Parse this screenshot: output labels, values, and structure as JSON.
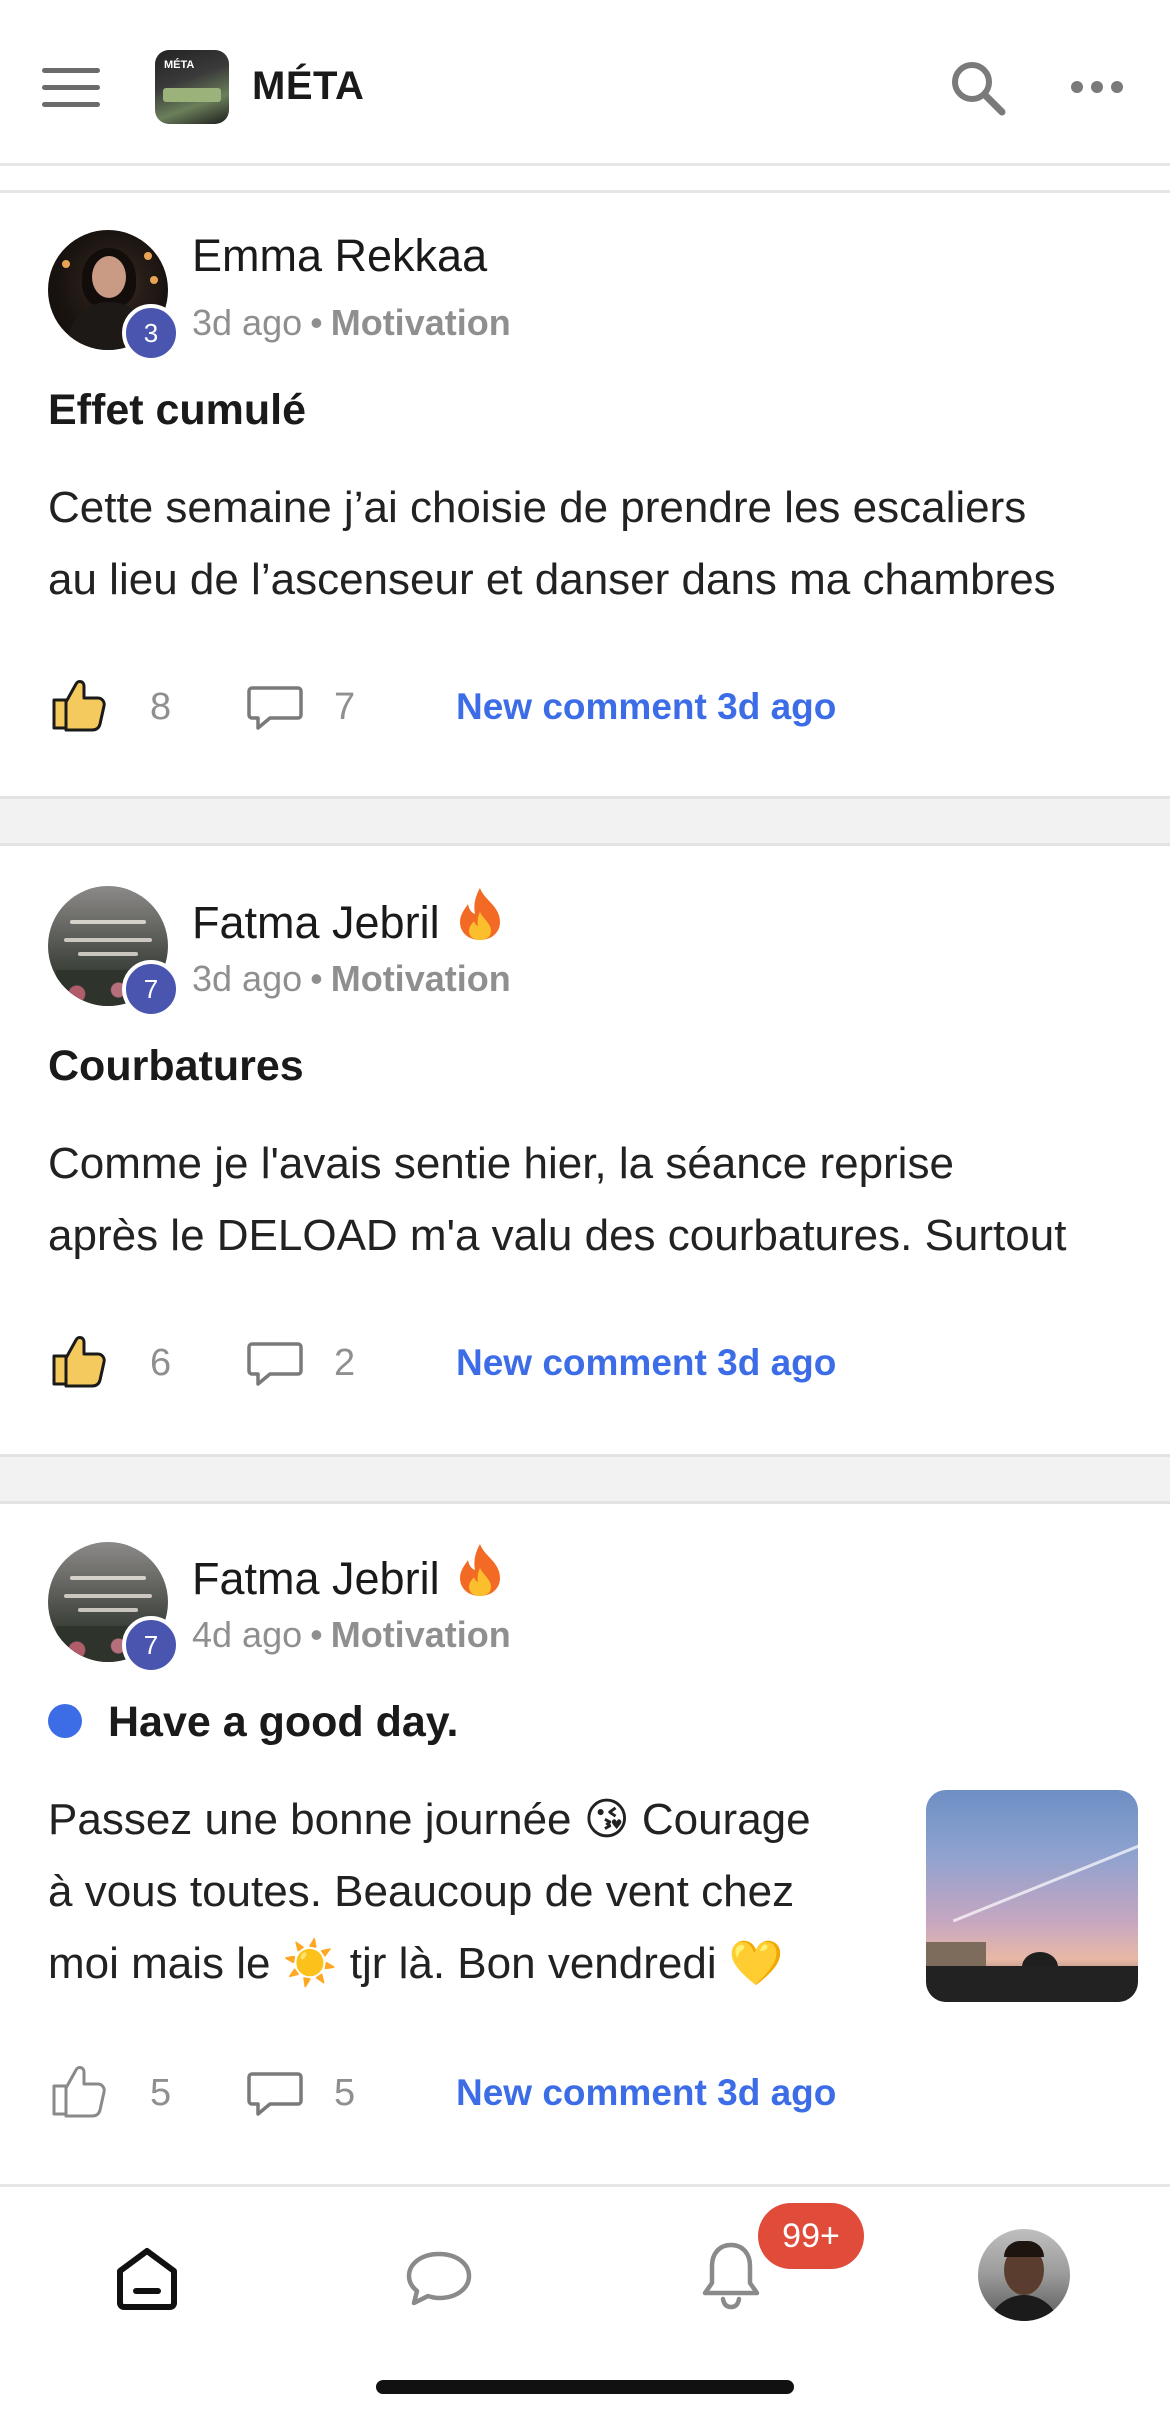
{
  "header": {
    "app_logo_text": "MÉTA",
    "app_title": "MÉTA",
    "icons": {
      "menu": "hamburger-icon",
      "search": "search-icon",
      "more": "more-horizontal-icon"
    }
  },
  "posts": [
    {
      "author": "Emma Rekkaa",
      "level": "3",
      "has_flame": false,
      "time": "3d ago",
      "separator": "•",
      "category": "Motivation",
      "title": "Effet cumulé",
      "unread": false,
      "body_lines": [
        "Cette semaine j’ai choisie de prendre les escaliers",
        "au lieu de l’ascenseur et danser dans ma chambres"
      ],
      "likes": "8",
      "liked": true,
      "comments": "7",
      "activity": "New comment 3d ago"
    },
    {
      "author": "Fatma Jebril",
      "level": "7",
      "has_flame": true,
      "time": "3d ago",
      "separator": "•",
      "category": "Motivation",
      "title": "Courbatures",
      "unread": false,
      "body_lines": [
        "Comme je l'avais sentie hier, la séance reprise",
        "après le DELOAD m'a valu des courbatures. Surtout"
      ],
      "likes": "6",
      "liked": true,
      "comments": "2",
      "activity": "New comment 3d ago"
    },
    {
      "author": "Fatma Jebril",
      "level": "7",
      "has_flame": true,
      "time": "4d ago",
      "separator": "•",
      "category": "Motivation",
      "title": "Have a good day.",
      "unread": true,
      "body_lines": [
        "Passez une bonne journée 😘 Courage",
        "à vous toutes. Beaucoup de vent chez",
        "moi mais le ☀️ tjr là. Bon vendredi 💛"
      ],
      "likes": "5",
      "liked": false,
      "comments": "5",
      "activity": "New comment 3d ago"
    }
  ],
  "bottom_nav": {
    "items": [
      "home-icon",
      "chat-icon",
      "bell-icon",
      "profile-avatar"
    ],
    "notification_badge": "99+"
  },
  "colors": {
    "accent": "#3d6de6",
    "level_badge": "#4a55b0",
    "notification": "#e04b3a",
    "like_fill": "#f4c95d"
  }
}
